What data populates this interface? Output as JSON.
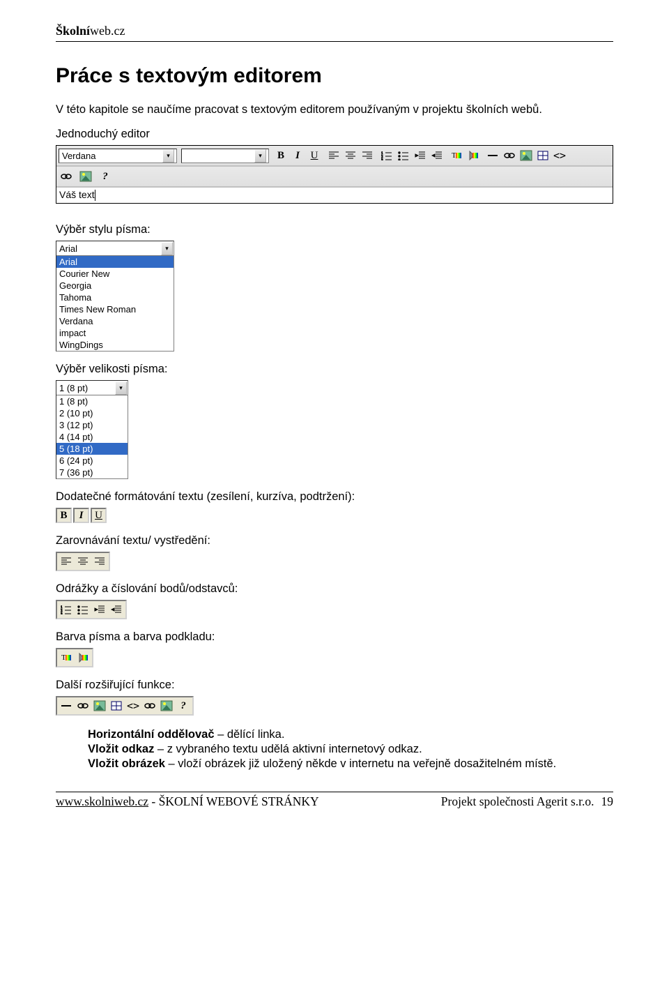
{
  "header": {
    "brand_bold": "Školní",
    "brand_rest": "web.cz"
  },
  "title": "Práce s textovým editorem",
  "intro": "V této kapitole se naučíme pracovat s textovým editorem používaným v projektu školních webů.",
  "labels": {
    "simple_editor": "Jednoduchý editor",
    "font_style": "Výběr stylu písma:",
    "font_size": "Výběr velikosti písma:",
    "extra_formatting": "Dodatečné formátování textu (zesílení, kurzíva, podtržení):",
    "alignment": "Zarovnávání textu/ vystředění:",
    "bullets": "Odrážky a číslování bodů/odstavců:",
    "colors": "Barva písma a barva podkladu:",
    "more": "Další rozšiřující funkce:"
  },
  "toolbar": {
    "font_selected": "Verdana",
    "size_selected": ""
  },
  "editor_text": "Váš text",
  "font_dropdown": {
    "selected": "Arial",
    "options": [
      "Arial",
      "Courier New",
      "Georgia",
      "Tahoma",
      "Times New Roman",
      "Verdana",
      "impact",
      "WingDings"
    ]
  },
  "size_dropdown": {
    "selected": "1 (8 pt)",
    "options": [
      "1 (8 pt)",
      "2 (10 pt)",
      "3 (12 pt)",
      "4 (14 pt)",
      "5 (18 pt)",
      "6 (24 pt)",
      "7 (36 pt)"
    ],
    "highlighted_index": 4
  },
  "fn_rows": [
    {
      "bold": "Horizontální oddělovač",
      "rest": " – dělící linka."
    },
    {
      "bold": "Vložit odkaz",
      "rest": " – z vybraného textu udělá aktivní internetový odkaz."
    },
    {
      "bold": "Vložit obrázek",
      "rest": " – vloží obrázek již uložený někde v internetu na veřejně dosažitelném místě."
    }
  ],
  "footer": {
    "url": "www.skolniweb.cz",
    "mid": " - ŠKOLNÍ WEBOVÉ STRÁNKY",
    "right": "Projekt společnosti Agerit s.r.o.",
    "page": "19"
  }
}
